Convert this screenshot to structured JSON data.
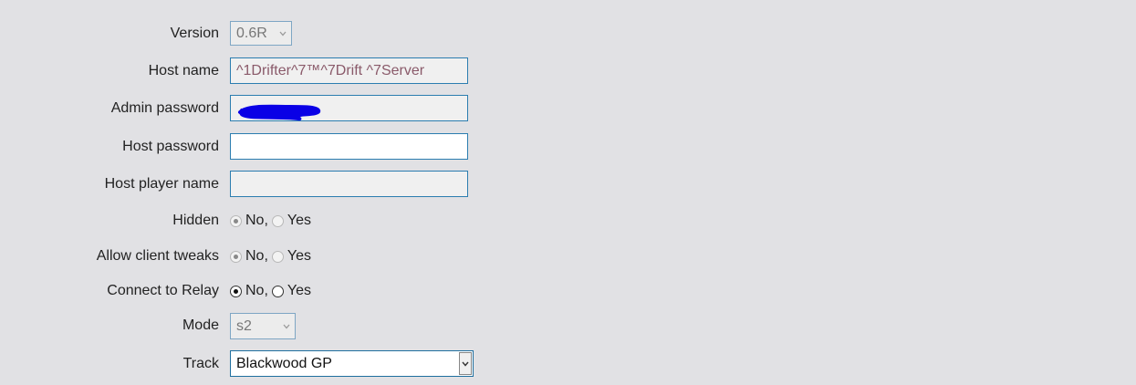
{
  "form": {
    "version": {
      "label": "Version",
      "value": "0.6R"
    },
    "host_name": {
      "label": "Host name",
      "value": "^1Drifter^7™^7Drift ^7Server"
    },
    "admin_password": {
      "label": "Admin password",
      "value": ""
    },
    "host_password": {
      "label": "Host password",
      "value": ""
    },
    "host_player_name": {
      "label": "Host player name",
      "value": ""
    },
    "hidden": {
      "label": "Hidden",
      "options": [
        "No,",
        "Yes"
      ],
      "selected": "No,"
    },
    "allow_client_tweaks": {
      "label": "Allow client tweaks",
      "options": [
        "No,",
        "Yes"
      ],
      "selected": "No,"
    },
    "connect_to_relay": {
      "label": "Connect to Relay",
      "options": [
        "No,",
        "Yes"
      ],
      "selected": "No,"
    },
    "mode": {
      "label": "Mode",
      "value": "s2"
    },
    "track": {
      "label": "Track",
      "value": "Blackwood GP"
    }
  },
  "colors": {
    "background": "#e1e1e4",
    "input_border": "#2b7db0",
    "redaction": "#0a00e6"
  }
}
